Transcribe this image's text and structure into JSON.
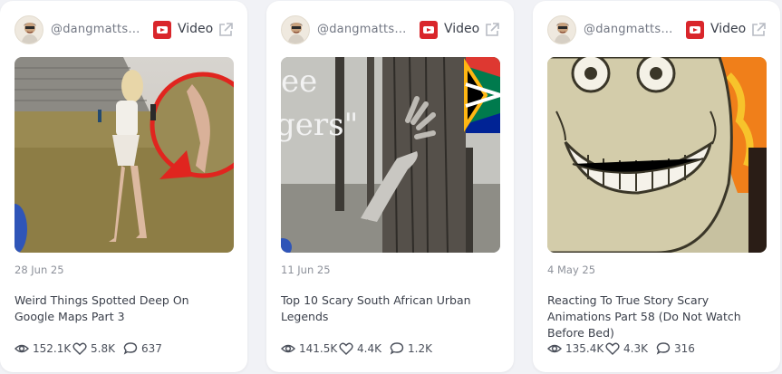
{
  "cards": [
    {
      "handle": "@dangmattsm...",
      "type_label": "Video",
      "date": "28 Jun 25",
      "title": "Weird Things Spotted Deep On Google Maps Part 3",
      "views": "152.1K",
      "likes": "5.8K",
      "comments": "637"
    },
    {
      "handle": "@dangmattsm...",
      "type_label": "Video",
      "date": "11 Jun 25",
      "title": "Top 10 Scary South African Urban Legends",
      "thumb_text": "ee\ngers\"",
      "views": "141.5K",
      "likes": "4.4K",
      "comments": "1.2K"
    },
    {
      "handle": "@dangmattsm...",
      "type_label": "Video",
      "date": "4 May 25",
      "title": "Reacting To True Story Scary Animations Part 58 (Do Not Watch Before Bed)",
      "views": "135.4K",
      "likes": "4.3K",
      "comments": "316"
    }
  ],
  "icons": {
    "platform": "youtube-icon",
    "open": "external-link-icon",
    "views": "eye-icon",
    "likes": "heart-icon",
    "comments": "comment-icon"
  },
  "colors": {
    "youtube_red": "#d9262b",
    "card_bg": "#ffffff",
    "page_bg": "#f1f2f6",
    "muted_text": "#8d919a"
  }
}
